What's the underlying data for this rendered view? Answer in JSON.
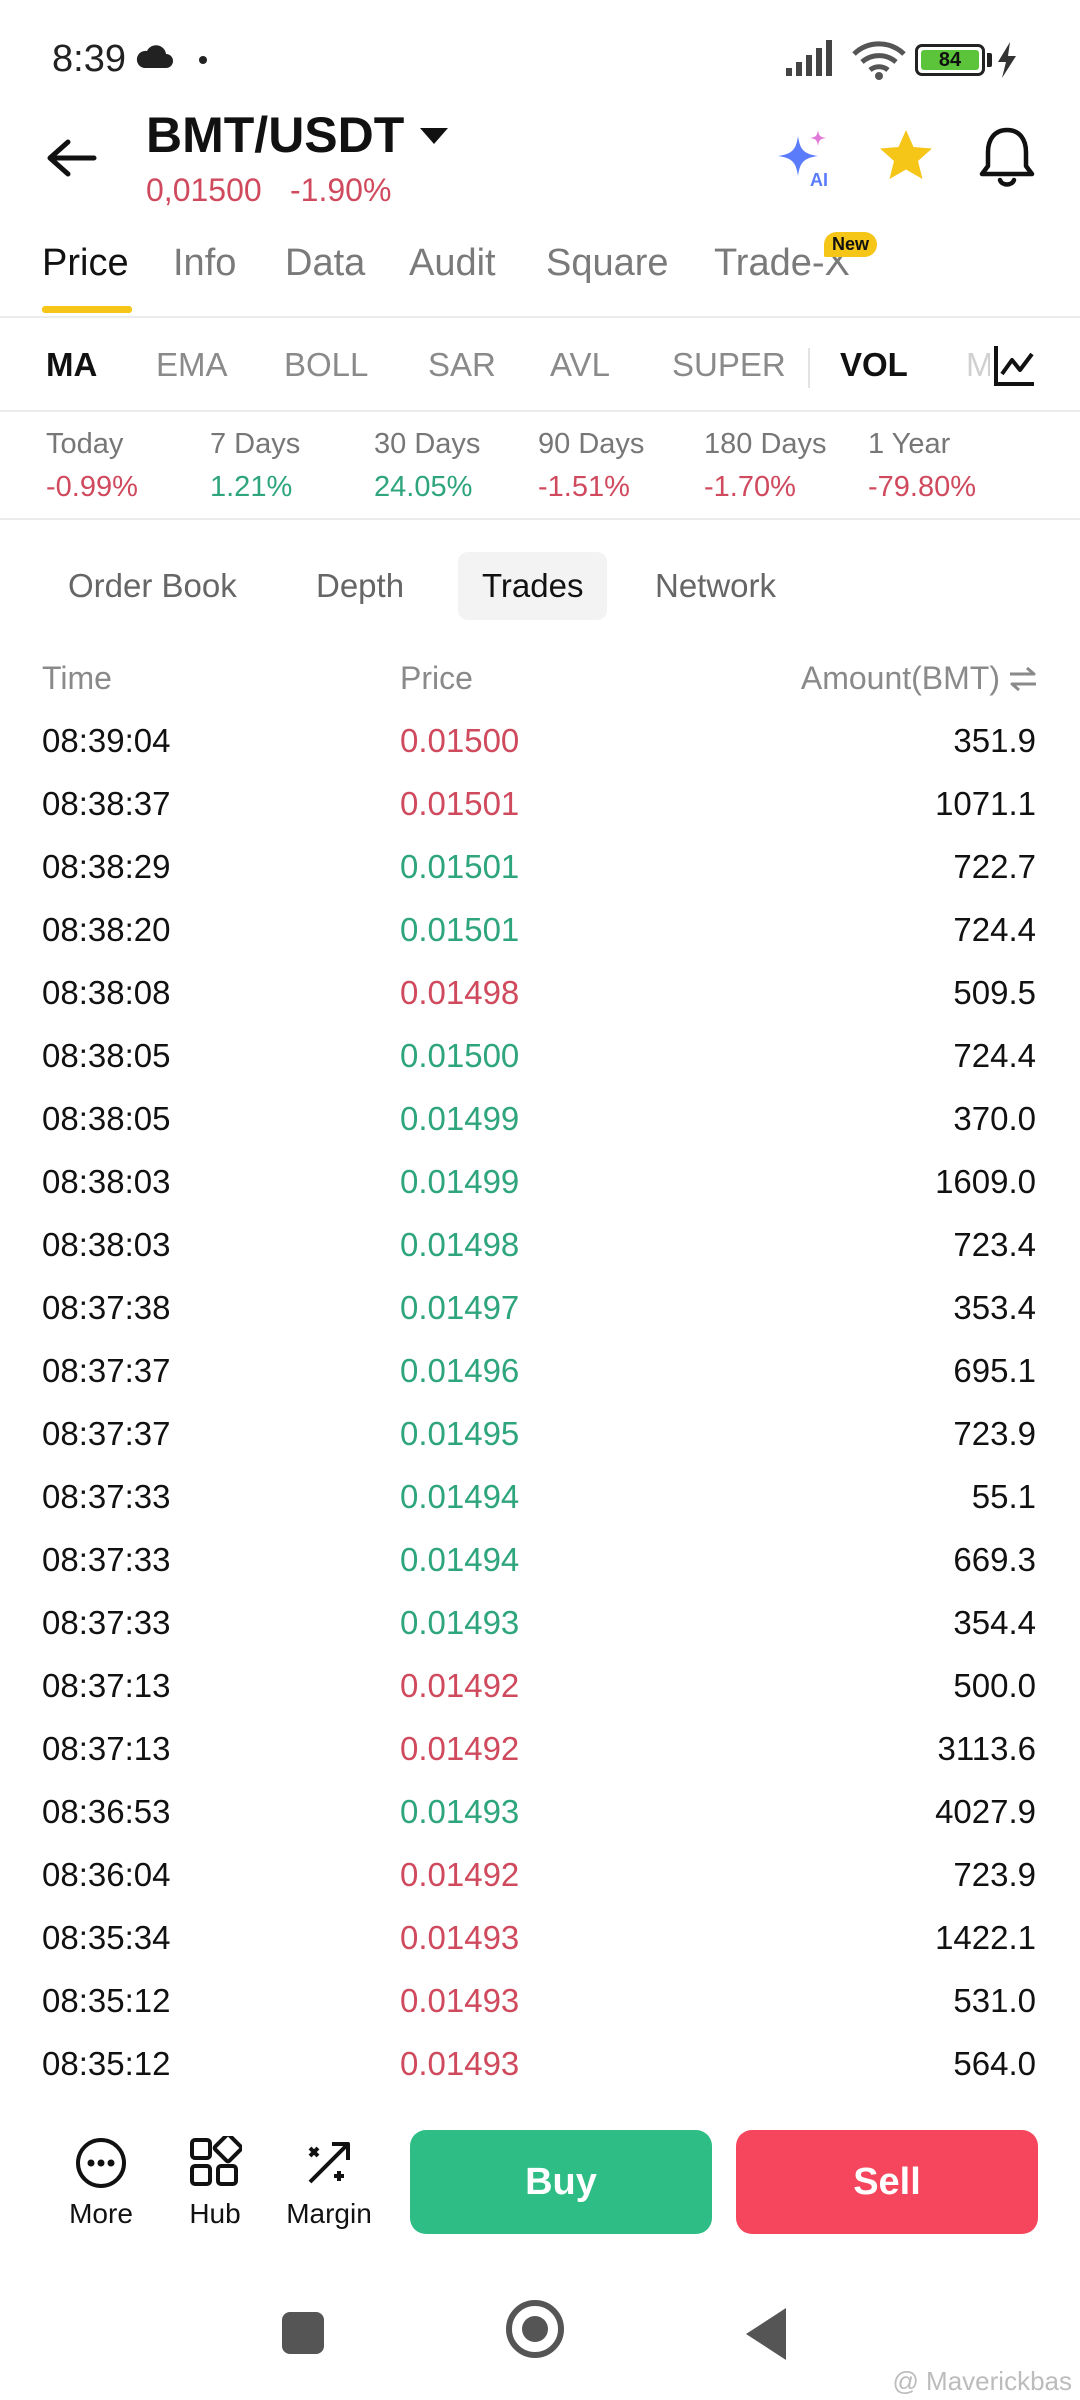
{
  "status_bar": {
    "time": "8:39",
    "battery": "84"
  },
  "header": {
    "pair": "BMT/USDT",
    "price": "0,01500",
    "change": "-1.90%"
  },
  "top_tabs": [
    {
      "label": "Price"
    },
    {
      "label": "Info"
    },
    {
      "label": "Data"
    },
    {
      "label": "Audit"
    },
    {
      "label": "Square"
    },
    {
      "label": "Trade-X"
    }
  ],
  "new_badge": "New",
  "indicators": [
    "MA",
    "EMA",
    "BOLL",
    "SAR",
    "AVL",
    "SUPER",
    "VOL",
    "M"
  ],
  "performance": [
    {
      "label": "Today",
      "value": "-0.99%"
    },
    {
      "label": "7 Days",
      "value": "1.21%"
    },
    {
      "label": "30 Days",
      "value": "24.05%"
    },
    {
      "label": "90 Days",
      "value": "-1.51%"
    },
    {
      "label": "180 Days",
      "value": "-1.70%"
    },
    {
      "label": "1 Year",
      "value": "-79.80%"
    }
  ],
  "sub_tabs": [
    "Order Book",
    "Depth",
    "Trades",
    "Network"
  ],
  "table": {
    "headers": {
      "time": "Time",
      "price": "Price",
      "amount": "Amount(BMT)"
    },
    "rows": [
      {
        "time": "08:39:04",
        "price": "0.01500",
        "amount": "351.9",
        "side": "sell"
      },
      {
        "time": "08:38:37",
        "price": "0.01501",
        "amount": "1071.1",
        "side": "sell"
      },
      {
        "time": "08:38:29",
        "price": "0.01501",
        "amount": "722.7",
        "side": "buy"
      },
      {
        "time": "08:38:20",
        "price": "0.01501",
        "amount": "724.4",
        "side": "buy"
      },
      {
        "time": "08:38:08",
        "price": "0.01498",
        "amount": "509.5",
        "side": "sell"
      },
      {
        "time": "08:38:05",
        "price": "0.01500",
        "amount": "724.4",
        "side": "buy"
      },
      {
        "time": "08:38:05",
        "price": "0.01499",
        "amount": "370.0",
        "side": "buy"
      },
      {
        "time": "08:38:03",
        "price": "0.01499",
        "amount": "1609.0",
        "side": "buy"
      },
      {
        "time": "08:38:03",
        "price": "0.01498",
        "amount": "723.4",
        "side": "buy"
      },
      {
        "time": "08:37:38",
        "price": "0.01497",
        "amount": "353.4",
        "side": "buy"
      },
      {
        "time": "08:37:37",
        "price": "0.01496",
        "amount": "695.1",
        "side": "buy"
      },
      {
        "time": "08:37:37",
        "price": "0.01495",
        "amount": "723.9",
        "side": "buy"
      },
      {
        "time": "08:37:33",
        "price": "0.01494",
        "amount": "55.1",
        "side": "buy"
      },
      {
        "time": "08:37:33",
        "price": "0.01494",
        "amount": "669.3",
        "side": "buy"
      },
      {
        "time": "08:37:33",
        "price": "0.01493",
        "amount": "354.4",
        "side": "buy"
      },
      {
        "time": "08:37:13",
        "price": "0.01492",
        "amount": "500.0",
        "side": "sell"
      },
      {
        "time": "08:37:13",
        "price": "0.01492",
        "amount": "3113.6",
        "side": "sell"
      },
      {
        "time": "08:36:53",
        "price": "0.01493",
        "amount": "4027.9",
        "side": "buy"
      },
      {
        "time": "08:36:04",
        "price": "0.01492",
        "amount": "723.9",
        "side": "sell"
      },
      {
        "time": "08:35:34",
        "price": "0.01493",
        "amount": "1422.1",
        "side": "sell"
      },
      {
        "time": "08:35:12",
        "price": "0.01493",
        "amount": "531.0",
        "side": "sell"
      },
      {
        "time": "08:35:12",
        "price": "0.01493",
        "amount": "564.0",
        "side": "sell"
      }
    ]
  },
  "bottom_bar": {
    "more": "More",
    "hub": "Hub",
    "margin": "Margin",
    "buy": "Buy",
    "sell": "Sell"
  },
  "watermark": "@ Maverickbas",
  "colors": {
    "accent_yellow": "#f5c518",
    "up_green": "#2ebd85",
    "down_red": "#f6465d",
    "price_red": "#d04a5e",
    "price_green": "#2ea57c"
  },
  "icons": [
    "back-arrow-icon",
    "caret-down-icon",
    "ai-sparkle-icon",
    "star-icon",
    "bell-icon",
    "chart-settings-icon",
    "swap-icon",
    "more-icon",
    "hub-icon",
    "margin-icon"
  ]
}
